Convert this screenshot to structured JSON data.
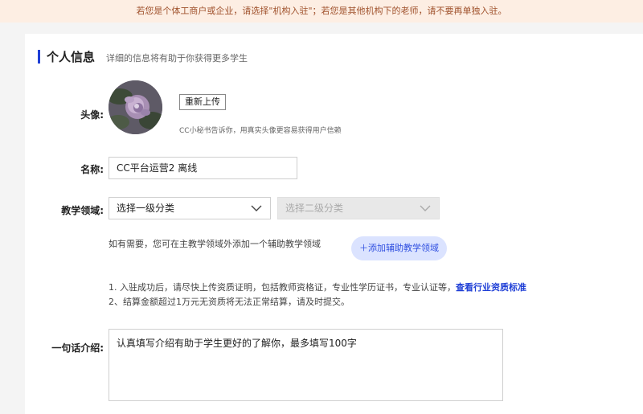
{
  "notice": {
    "text": "若您是个体工商户或企业，请选择\"机构入驻\"；若您是其他机构下的老师，请不要再单独入驻。"
  },
  "section": {
    "title": "个人信息",
    "subtitle": "详细的信息将有助于你获得更多学生"
  },
  "avatar": {
    "label": "头像:",
    "reupload_label": "重新上传",
    "tip": "CC小秘书告诉你，用真实头像更容易获得用户信赖"
  },
  "name_field": {
    "label": "名称:",
    "value": "CC平台运营2 离线"
  },
  "teaching": {
    "label": "教学领域:",
    "primary_placeholder": "选择一级分类",
    "secondary_placeholder": "选择二级分类",
    "hint": "如有需要，您可在主教学领域外添加一个辅助教学领域",
    "add_label": "＋添加辅助教学领域"
  },
  "notes": {
    "line1": "1. 入驻成功后，请尽快上传资质证明，包括教师资格证，专业性学历证书，专业认证等，",
    "line1_link": "查看行业资质标准",
    "line2": "2、结算金额超过1万元无资质将无法正常结算，请及时提交。"
  },
  "intro": {
    "label": "一句话介绍:",
    "value": "认真填写介绍有助于学生更好的了解你，最多填写100字"
  },
  "colors": {
    "accent": "#1f3fd6",
    "notice_bg": "#fdeee3",
    "pill_bg": "#dbe3ff"
  }
}
